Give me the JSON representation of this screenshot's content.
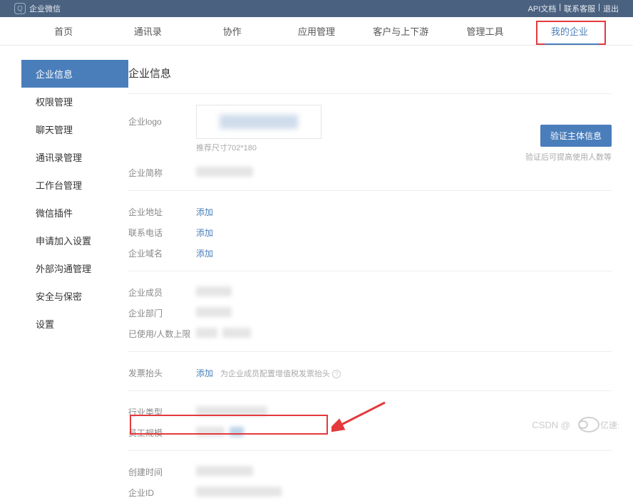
{
  "brand": "企业微信",
  "toplinks": {
    "api": "API文档",
    "sep1": "|",
    "cs": "联系客服",
    "sep2": "|",
    "logout": "退出"
  },
  "nav": [
    "首页",
    "通讯录",
    "协作",
    "应用管理",
    "客户与上下游",
    "管理工具",
    "我的企业"
  ],
  "sidebar": [
    "企业信息",
    "权限管理",
    "聊天管理",
    "通讯录管理",
    "工作台管理",
    "微信插件",
    "申请加入设置",
    "外部沟通管理",
    "安全与保密",
    "设置"
  ],
  "title": "企业信息",
  "rows": {
    "logo_label": "企业logo",
    "logo_tip": "推荐尺寸702*180",
    "verify_btn": "验证主体信息",
    "verify_tip": "验证后可提高使用人数等",
    "shortname": "企业简称",
    "address": "企业地址",
    "phone": "联系电话",
    "domain": "企业域名",
    "add": "添加",
    "members": "企业成员",
    "depts": "企业部门",
    "used": "已使用/人数上限",
    "invoice": "发票抬头",
    "invoice_tip": "为企业成员配置增值税发票抬头",
    "industry": "行业类型",
    "size": "员工规模",
    "created": "创建时间",
    "corpid": "企业ID"
  },
  "watermark": "CSDN @"
}
